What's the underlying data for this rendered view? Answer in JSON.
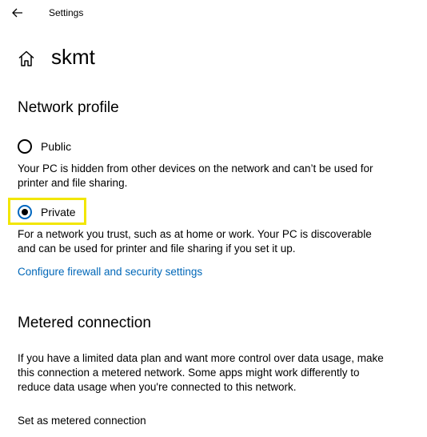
{
  "titlebar": {
    "back_icon": "arrow-left-icon",
    "title": "Settings"
  },
  "header": {
    "home_icon": "home-icon",
    "title": "skmt"
  },
  "network_profile": {
    "heading": "Network profile",
    "options": [
      {
        "label": "Public",
        "selected": false,
        "description": "Your PC is hidden from other devices on the network and can’t be used for printer and file sharing."
      },
      {
        "label": "Private",
        "selected": true,
        "description": "For a network you trust, such as at home or work. Your PC is discoverable and can be used for printer and file sharing if you set it up."
      }
    ],
    "link": "Configure firewall and security settings"
  },
  "metered": {
    "heading": "Metered connection",
    "description": "If you have a limited data plan and want more control over data usage, make this connection a metered network. Some apps might work differently to reduce data usage when you're connected to this network.",
    "setting_label": "Set as metered connection"
  },
  "colors": {
    "accent": "#0067b8",
    "highlight": "#f2e600"
  }
}
